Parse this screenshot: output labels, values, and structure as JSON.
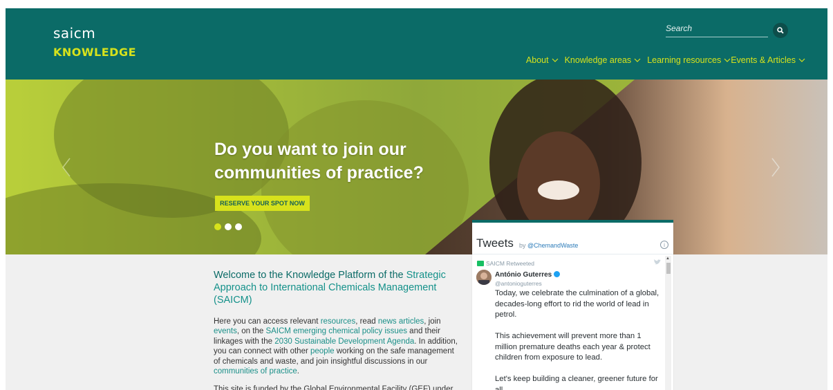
{
  "header": {
    "logo_wordmark": "saicm",
    "logo_subtitle": "KNOWLEDGE",
    "search_placeholder": "Search",
    "nav": [
      {
        "label": "About"
      },
      {
        "label": "Knowledge areas"
      },
      {
        "label": "Learning resources"
      },
      {
        "label": "Events & Articles"
      }
    ]
  },
  "hero": {
    "title": "Do you want to join our communities of practice?",
    "cta_label": "RESERVE YOUR SPOT NOW",
    "active_slide": 1,
    "slide_count": 3
  },
  "main": {
    "welcome_plain": "Welcome to the Knowledge Platform of the ",
    "welcome_highlight": "Strategic Approach to International Chemicals Management (SAICM)",
    "para": {
      "t1": "Here you can access relevant ",
      "l1": "resources",
      "t2": ", read ",
      "l2": "news articles",
      "t3": ", join ",
      "l3": "events",
      "t4": ", on the ",
      "l4": "SAICM emerging chemical policy issues",
      "t5": " and their linkages with the ",
      "l5": "2030 Sustainable Development Agenda",
      "t6": ". In addition, you can connect with other ",
      "l6": "people",
      "t7": " working on the safe management of chemicals and waste, and join insightful discussions in our ",
      "l7": "communities of practice",
      "t8": "."
    },
    "para2": "This site is funded by the Global Environmental Facility (GEF) under"
  },
  "tweets": {
    "title": "Tweets",
    "by_prefix": "by",
    "by_handle": "@ChemandWaste",
    "retweet_label": "SAICM Retweeted",
    "author": "António Guterres",
    "handle": "@antonioguterres",
    "paragraphs": [
      "Today, we celebrate the culmination of a global, decades-long effort to rid the world of lead in petrol.",
      "This achievement will prevent more than 1 million premature deaths each year & protect children from exposure to lead.",
      "Let's keep building a cleaner, greener future for all."
    ]
  },
  "colors": {
    "brand_teal": "#0b6b67",
    "accent_yellow": "#d7e21c",
    "link_teal": "#1a8f88"
  }
}
